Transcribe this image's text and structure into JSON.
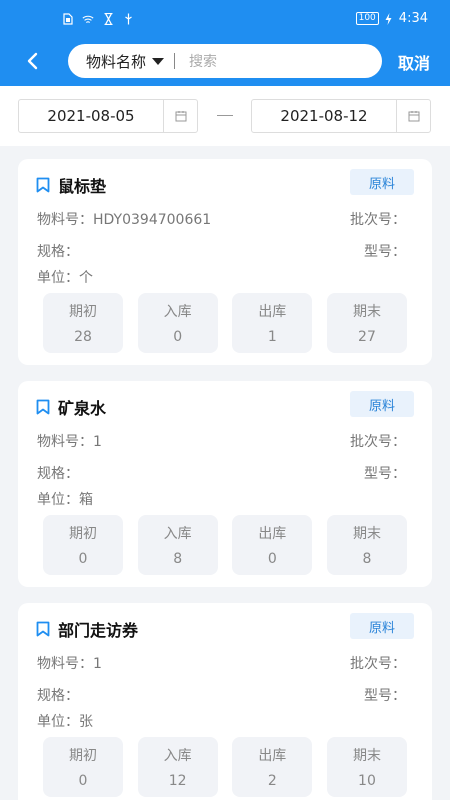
{
  "status_bar": {
    "time": "4:34",
    "battery": "100",
    "left_icons": [
      "sim-icon",
      "wifi-icon",
      "hourglass-icon",
      "usb-icon"
    ]
  },
  "header": {
    "search_type": "物料名称",
    "search_placeholder": "搜索",
    "cancel_label": "取消",
    "bg_color": "#1f8ef1"
  },
  "date_range": {
    "start": "2021-08-05",
    "end": "2021-08-12"
  },
  "labels": {
    "material_no": "物料号：",
    "batch_no": "批次号：",
    "spec": "规格：",
    "model": "型号：",
    "unit": "单位："
  },
  "items": [
    {
      "name": "鼠标垫",
      "category": "原料",
      "material_no": "HDY0394700661",
      "unit": "个",
      "stats": [
        {
          "label": "期初",
          "value": "28"
        },
        {
          "label": "入库",
          "value": "0"
        },
        {
          "label": "出库",
          "value": "1"
        },
        {
          "label": "期末",
          "value": "27"
        }
      ]
    },
    {
      "name": "矿泉水",
      "category": "原料",
      "material_no": "1",
      "unit": "箱",
      "stats": [
        {
          "label": "期初",
          "value": "0"
        },
        {
          "label": "入库",
          "value": "8"
        },
        {
          "label": "出库",
          "value": "0"
        },
        {
          "label": "期末",
          "value": "8"
        }
      ]
    },
    {
      "name": "部门走访券",
      "category": "原料",
      "material_no": "1",
      "unit": "张",
      "stats": [
        {
          "label": "期初",
          "value": "0"
        },
        {
          "label": "入库",
          "value": "12"
        },
        {
          "label": "出库",
          "value": "2"
        },
        {
          "label": "期末",
          "value": "10"
        }
      ]
    }
  ]
}
